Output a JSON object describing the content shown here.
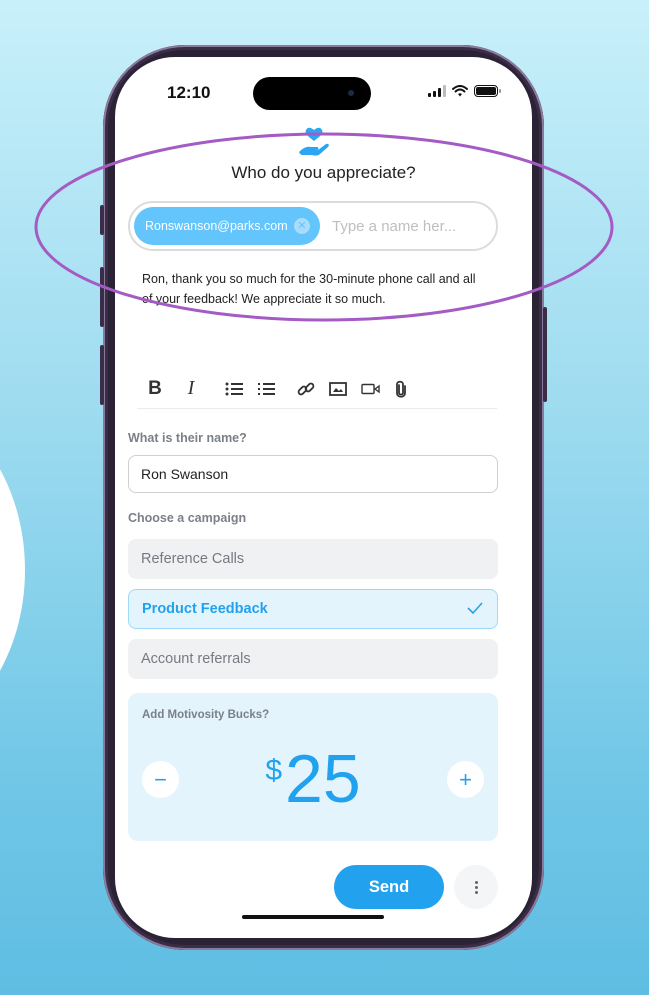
{
  "status_bar": {
    "time": "12:10",
    "icons": [
      "signal-icon",
      "wifi-icon",
      "battery-icon"
    ]
  },
  "header": {
    "logo_icon": "hand-heart-icon",
    "title": "Who do you appreciate?"
  },
  "recipient": {
    "chip_label": "Ronswanson@parks.com",
    "chip_remove_icon": "close-circle-icon",
    "input_value": "",
    "input_placeholder": "Type a name her..."
  },
  "message": {
    "text": "Ron, thank you so much for the 30-minute phone call and all of your feedback! We appreciate it so much."
  },
  "toolbar": {
    "bold_label": "B",
    "italic_label": "I",
    "icons": [
      "bold-icon",
      "italic-icon",
      "bullet-list-icon",
      "numbered-list-icon",
      "link-icon",
      "image-icon",
      "video-icon",
      "attachment-icon"
    ]
  },
  "name_field": {
    "label": "What is their name?",
    "value": "Ron Swanson"
  },
  "campaign": {
    "label": "Choose a campaign",
    "options": [
      {
        "label": "Reference Calls",
        "selected": false
      },
      {
        "label": "Product Feedback",
        "selected": true
      },
      {
        "label": "Account referrals",
        "selected": false
      }
    ]
  },
  "bucks": {
    "label": "Add Motivosity Bucks?",
    "currency": "$",
    "amount": "25",
    "minus_label": "−",
    "plus_label": "+"
  },
  "actions": {
    "send_label": "Send",
    "more_icon": "more-vertical-icon"
  },
  "colors": {
    "accent": "#22a2ee",
    "chip": "#64c4fc",
    "selected_bg": "#e3f4fd",
    "highlight_ellipse": "#a45bc4",
    "phone_frame": "#2c2236"
  }
}
